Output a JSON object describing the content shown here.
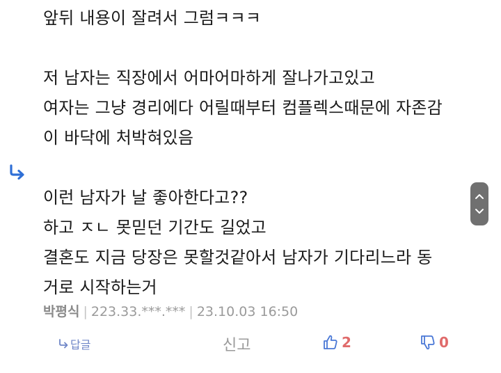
{
  "comment": {
    "lines": [
      "앞뒤 내용이 잘려서 그럼ㅋㅋㅋ",
      "",
      "저 남자는 직장에서 어마어마하게 잘나가고있고",
      "여자는 그냥 경리에다 어릴때부터 컴플렉스때문에 자존감",
      "이 바닥에 처박혀있음",
      "",
      "이런 남자가 날 좋아한다고??",
      "하고 ㅈㄴ 못믿던 기간도 길었고",
      "결혼도 지금 당장은 못할것같아서 남자가 기다리느라 동",
      "거로 시작하는거"
    ]
  },
  "meta": {
    "author": "박평식",
    "ip": "223.33.***.***",
    "datetime": "23.10.03 16:50"
  },
  "actions": {
    "reply_label": "답글",
    "report_label": "신고",
    "like_count": "2",
    "dislike_count": "0"
  },
  "icons": {
    "reply_indicator": "reply-arrow-icon",
    "like": "thumbs-up-icon",
    "dislike": "thumbs-down-icon",
    "scroll_up": "chevron-up-icon",
    "scroll_down": "chevron-down-icon"
  },
  "colors": {
    "accent": "#4a78d6",
    "vote": "#e06b6b",
    "meta_text": "#9a9a9a"
  }
}
